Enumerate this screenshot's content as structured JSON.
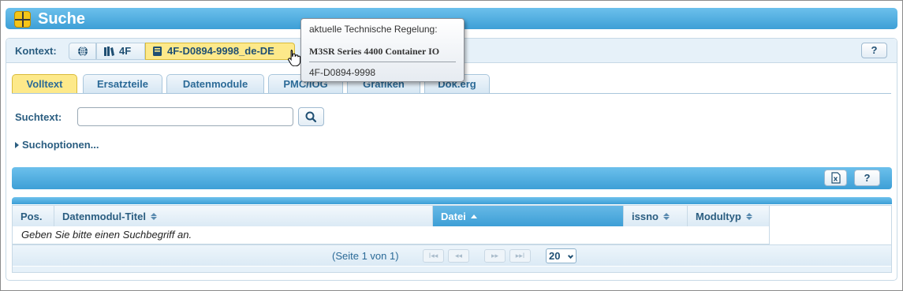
{
  "window": {
    "title": "Suche"
  },
  "context": {
    "label": "Kontext:",
    "crumbs": [
      {
        "icon": "globe-icon",
        "label": ""
      },
      {
        "icon": "book-stack-icon",
        "label": "4F"
      },
      {
        "icon": "book-icon",
        "label": "4F-D0894-9998_de-DE",
        "active": true
      }
    ],
    "help_label": "?"
  },
  "tabs": [
    {
      "label": "Volltext",
      "active": true
    },
    {
      "label": "Ersatzteile"
    },
    {
      "label": "Datenmodule"
    },
    {
      "label": "PMC/IOG"
    },
    {
      "label": "Grafiken"
    },
    {
      "label": "Dok.erg"
    }
  ],
  "search": {
    "label": "Suchtext:",
    "value": "",
    "placeholder": "",
    "options_label": "Suchoptionen..."
  },
  "results_toolbar": {
    "export_icon": "excel-export-icon",
    "help_label": "?"
  },
  "table": {
    "columns": [
      {
        "label": "Pos."
      },
      {
        "label": "Datenmodul-Titel",
        "sortable": true
      },
      {
        "label": "Datei",
        "sorted": "asc"
      },
      {
        "label": "issno",
        "sortable": true
      },
      {
        "label": "Modultyp",
        "sortable": true
      }
    ],
    "empty_message": "Geben Sie bitte einen Suchbegriff an.",
    "pager": {
      "page_info": "(Seite 1 von 1)",
      "page_size": "20",
      "first": "I◂◂",
      "prev": "◂◂",
      "next": "▸▸",
      "last": "▸▸I"
    }
  },
  "tooltip": {
    "heading": "aktuelle Technische Regelung:",
    "title": "M3SR Series 4400 Container IO",
    "code": "4F-D0894-9998"
  },
  "colors": {
    "accent_blue": "#3d9fd6",
    "highlight_yellow": "#fde98a",
    "label_blue": "#2a5d80"
  }
}
